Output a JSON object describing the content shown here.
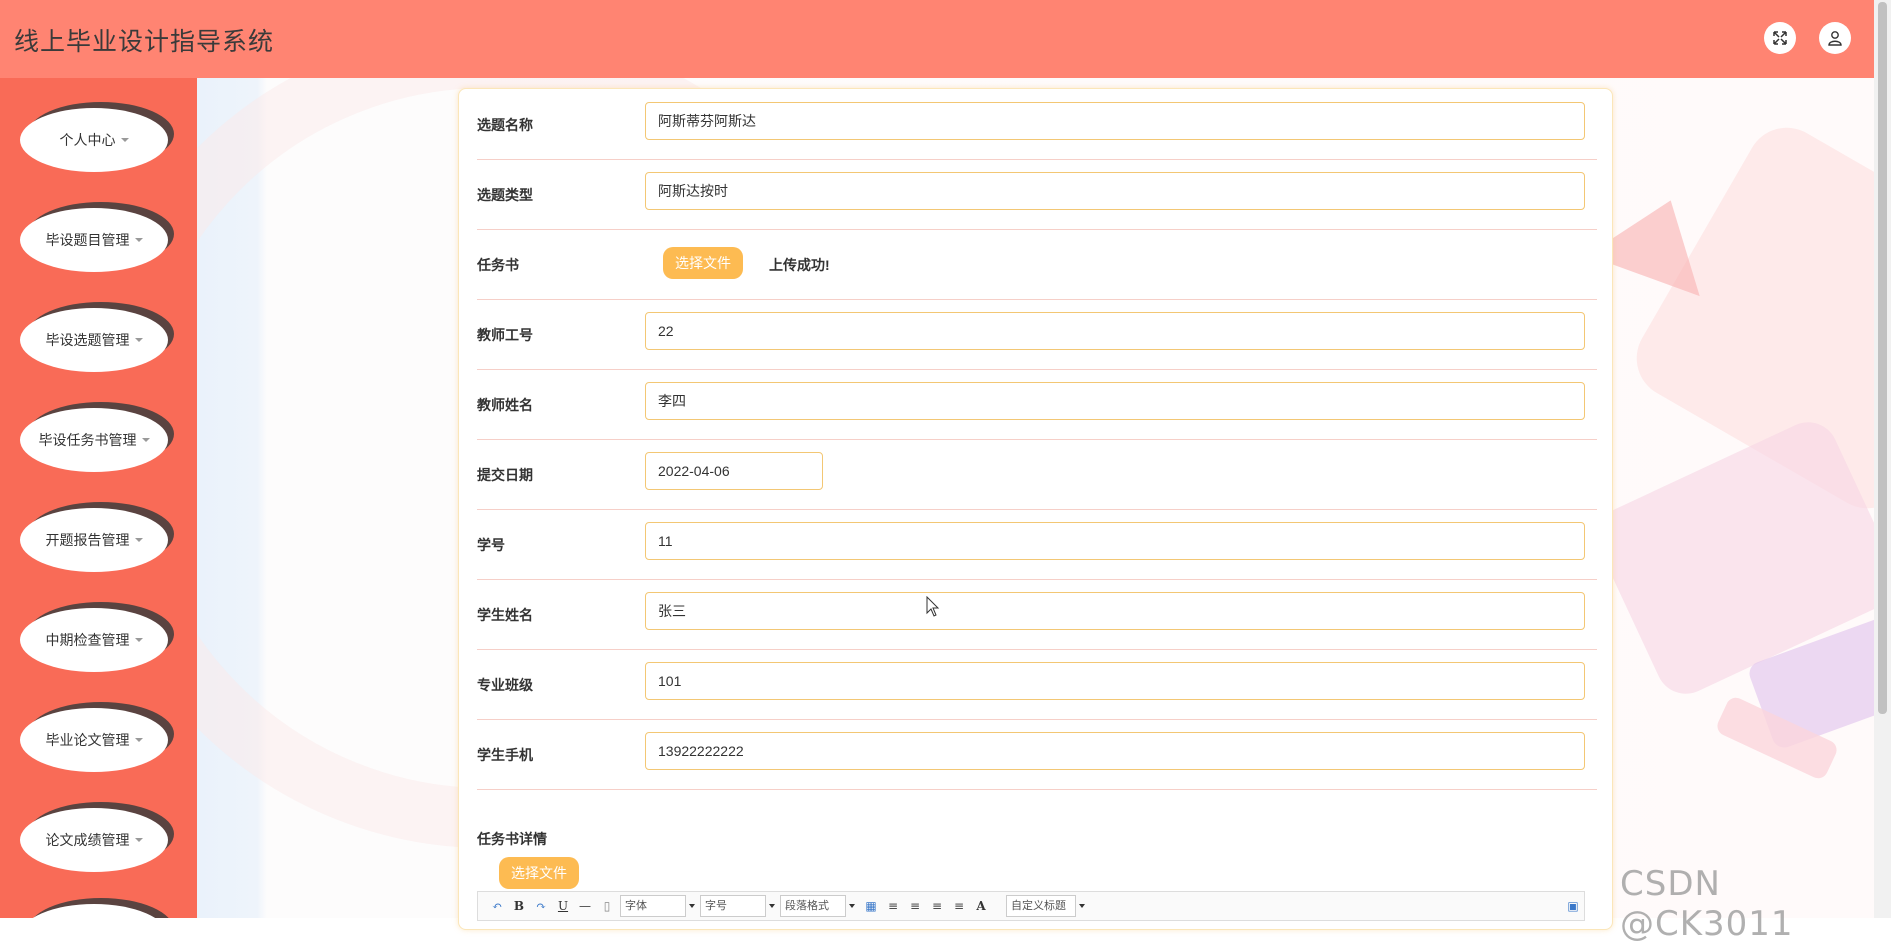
{
  "header": {
    "title": "线上毕业设计指导系统",
    "fullscreen_icon": "expand-icon",
    "user_icon": "user-icon"
  },
  "sidebar": {
    "items": [
      {
        "label": "个人中心"
      },
      {
        "label": "毕设题目管理"
      },
      {
        "label": "毕设选题管理"
      },
      {
        "label": "毕设任务书管理"
      },
      {
        "label": "开题报告管理"
      },
      {
        "label": "中期检查管理"
      },
      {
        "label": "毕业论文管理"
      },
      {
        "label": "论文成绩管理"
      }
    ]
  },
  "form": {
    "fields": [
      {
        "label": "选题名称",
        "value": "阿斯蒂芬阿斯达"
      },
      {
        "label": "选题类型",
        "value": "阿斯达按时"
      },
      {
        "label": "任务书",
        "button": "选择文件",
        "status": "上传成功!"
      },
      {
        "label": "教师工号",
        "value": "22"
      },
      {
        "label": "教师姓名",
        "value": "李四"
      },
      {
        "label": "提交日期",
        "value": "2022-04-06"
      },
      {
        "label": "学号",
        "value": "11"
      },
      {
        "label": "学生姓名",
        "value": "张三"
      },
      {
        "label": "专业班级",
        "value": "101"
      },
      {
        "label": "学生手机",
        "value": "13922222222"
      }
    ],
    "detail_label": "任务书详情",
    "detail_button": "选择文件"
  },
  "editor_toolbar": {
    "bold": "B",
    "underline": "U",
    "hr": "—",
    "font_family": "字体",
    "font_size": "字号",
    "paragraph": "段落格式",
    "font_color": "A",
    "custom_title": "自定义标题"
  },
  "watermark": "CSDN @CK3011",
  "colors": {
    "header": "#ff8472",
    "sidebar": "#f96b57",
    "button": "#fdbb52",
    "input_border": "#f3c774"
  }
}
